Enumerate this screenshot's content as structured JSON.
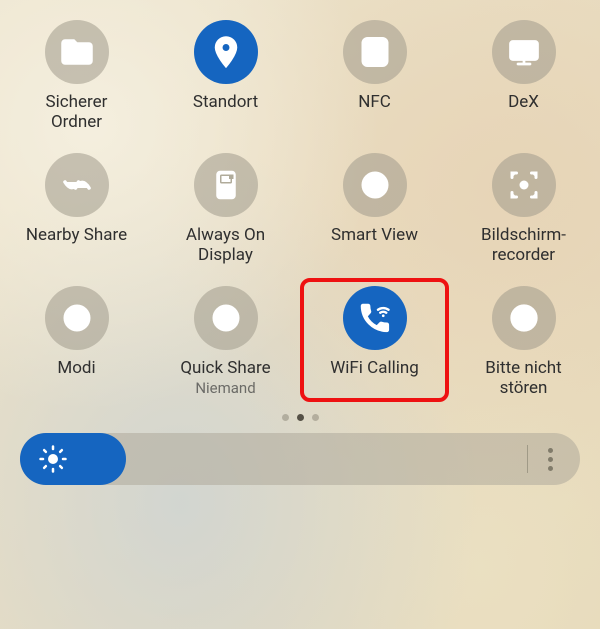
{
  "tiles": [
    {
      "id": "secure-folder",
      "label": "Sicherer\nOrdner",
      "sub": "",
      "active": false,
      "icon": "folder-lock"
    },
    {
      "id": "location",
      "label": "Standort",
      "sub": "",
      "active": true,
      "icon": "location-pin"
    },
    {
      "id": "nfc",
      "label": "NFC",
      "sub": "",
      "active": false,
      "icon": "nfc"
    },
    {
      "id": "dex",
      "label": "DeX",
      "sub": "",
      "active": false,
      "icon": "dex"
    },
    {
      "id": "nearby-share",
      "label": "Nearby Share",
      "sub": "",
      "active": false,
      "icon": "nearby"
    },
    {
      "id": "aod",
      "label": "Always On\nDisplay",
      "sub": "",
      "active": false,
      "icon": "aod"
    },
    {
      "id": "smart-view",
      "label": "Smart View",
      "sub": "",
      "active": false,
      "icon": "smart-view"
    },
    {
      "id": "screen-recorder",
      "label": "Bildschirm-\nrecorder",
      "sub": "",
      "active": false,
      "icon": "recorder"
    },
    {
      "id": "modes",
      "label": "Modi",
      "sub": "",
      "active": false,
      "icon": "modes"
    },
    {
      "id": "quick-share",
      "label": "Quick Share",
      "sub": "Niemand",
      "active": false,
      "icon": "quick-share"
    },
    {
      "id": "wifi-calling",
      "label": "WiFi Calling",
      "sub": "",
      "active": true,
      "icon": "wifi-call",
      "highlight": true
    },
    {
      "id": "dnd",
      "label": "Bitte nicht\nstören",
      "sub": "",
      "active": false,
      "icon": "dnd"
    }
  ],
  "pages": {
    "count": 3,
    "current": 1
  },
  "brightness": {
    "value_pct": 19
  }
}
